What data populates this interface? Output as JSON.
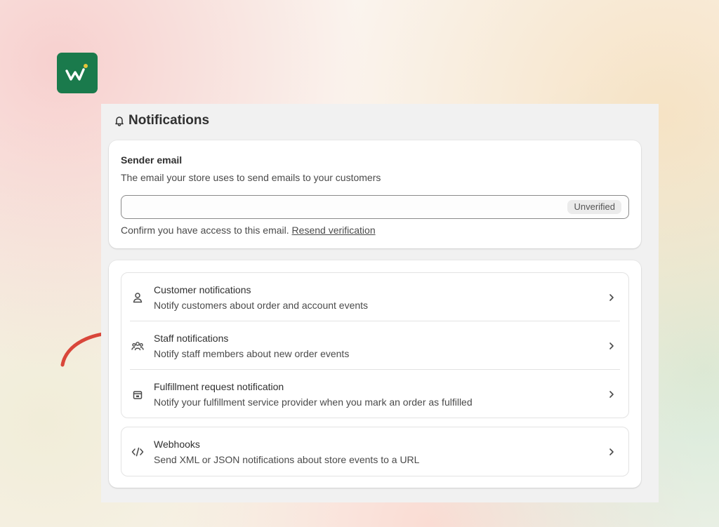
{
  "page": {
    "title": "Notifications",
    "icon": "bell-icon"
  },
  "sender": {
    "title": "Sender email",
    "description": "The email your store uses to send emails to your customers",
    "email_value": "",
    "badge": "Unverified",
    "confirm_text": "Confirm you have access to this email.",
    "resend_link": "Resend verification"
  },
  "notifications": [
    {
      "icon": "person-icon",
      "title": "Customer notifications",
      "description": "Notify customers about order and account events"
    },
    {
      "icon": "people-icon",
      "title": "Staff notifications",
      "description": "Notify staff members about new order events"
    },
    {
      "icon": "store-icon",
      "title": "Fulfillment request notification",
      "description": "Notify your fulfillment service provider when you mark an order as fulfilled"
    }
  ],
  "webhooks": {
    "icon": "code-icon",
    "title": "Webhooks",
    "description": "Send XML or JSON notifications about store events to a URL"
  },
  "colors": {
    "logo_bg": "#1a7a4c",
    "annotation_arrow": "#d9463a",
    "panel_bg": "#f1f1f1"
  }
}
